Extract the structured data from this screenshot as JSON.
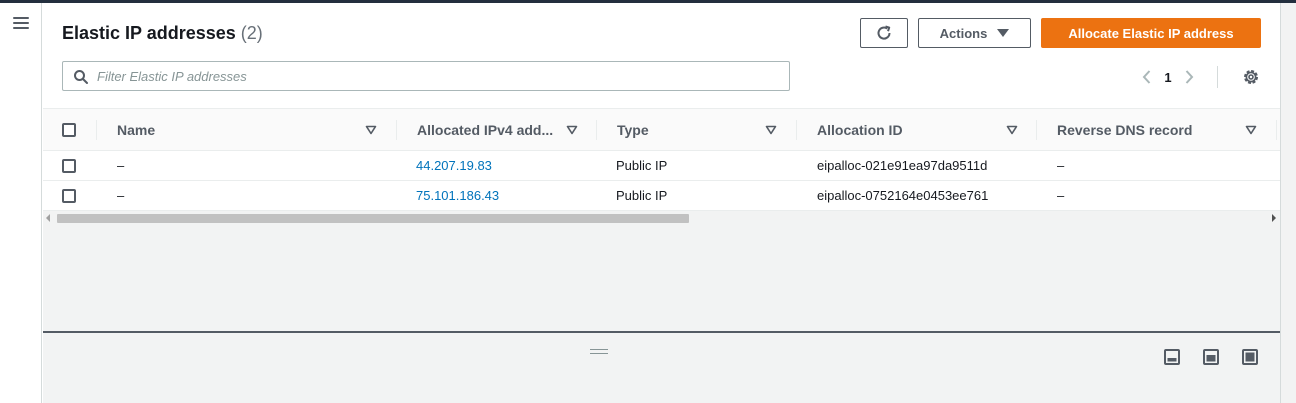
{
  "nav": {
    "menu_icon": "hamburger-menu-icon"
  },
  "header": {
    "title": "Elastic IP addresses",
    "count": "(2)",
    "refresh_icon": "refresh-icon",
    "actions_label": "Actions",
    "allocate_label": "Allocate Elastic IP address"
  },
  "filter": {
    "placeholder": "Filter Elastic IP addresses",
    "value": ""
  },
  "pagination": {
    "current_page": "1"
  },
  "table": {
    "columns": [
      "Name",
      "Allocated IPv4 add...",
      "Type",
      "Allocation ID",
      "Reverse DNS record"
    ],
    "rows": [
      {
        "name": "–",
        "ipv4": "44.207.19.83",
        "type": "Public IP",
        "allocation_id": "eipalloc-021e91ea97da9511d",
        "reverse_dns": "–"
      },
      {
        "name": "–",
        "ipv4": "75.101.186.43",
        "type": "Public IP",
        "allocation_id": "eipalloc-0752164e0453ee761",
        "reverse_dns": "–"
      }
    ]
  },
  "colors": {
    "primary": "#ec7211",
    "link": "#0073bb",
    "text": "#16191f",
    "muted": "#545b64"
  }
}
